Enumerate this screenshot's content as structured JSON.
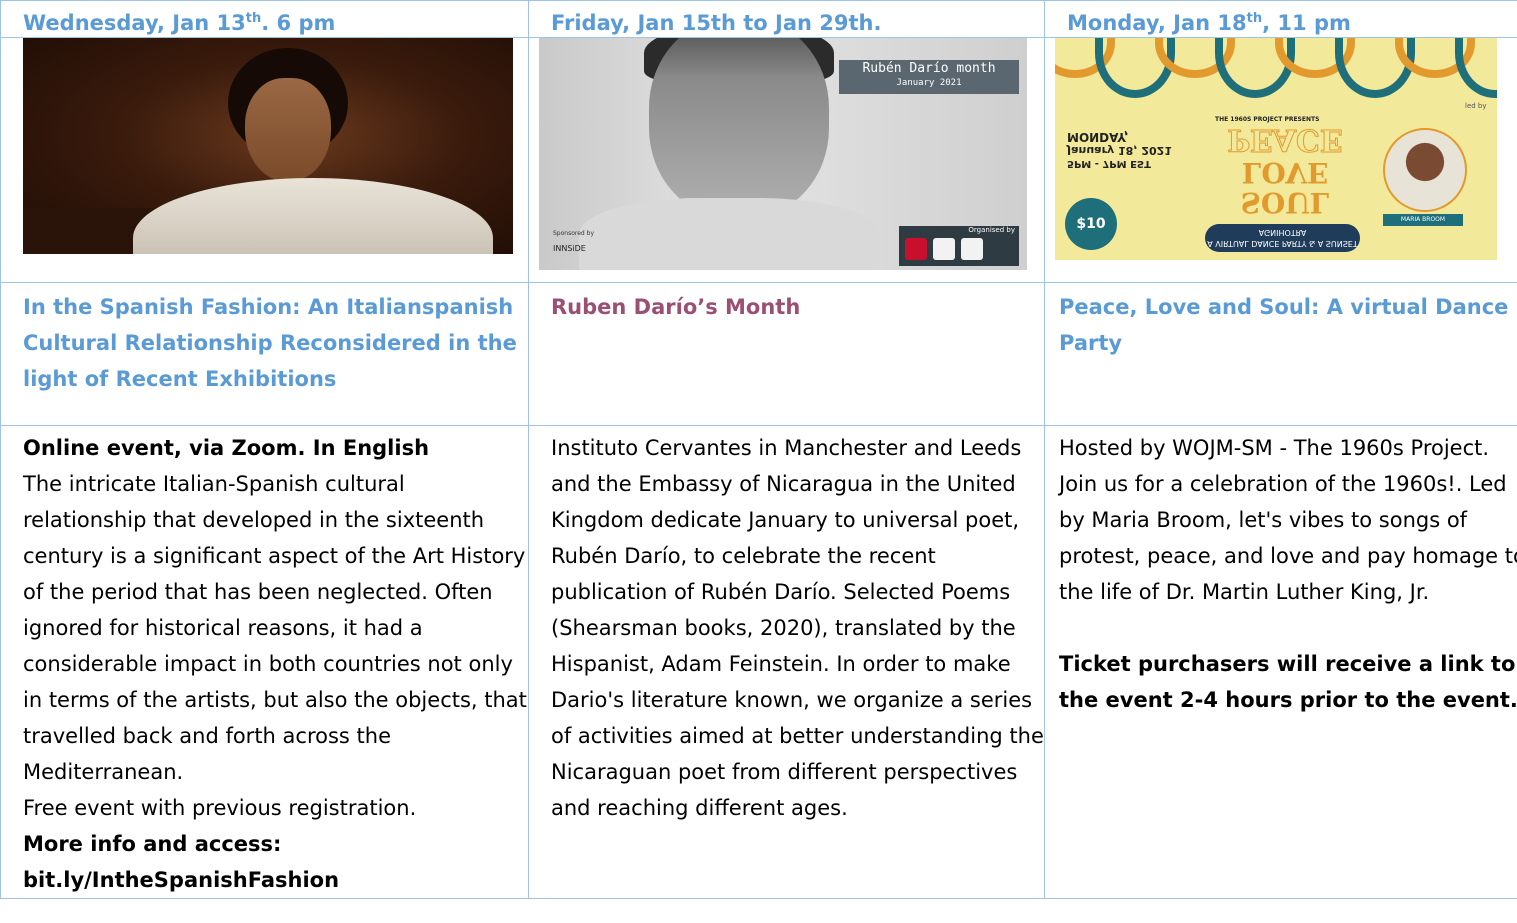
{
  "events": [
    {
      "date_prefix": "Wednesday, Jan 13",
      "date_sup": "th",
      "date_suffix": ". 6 pm",
      "title": "In the Spanish Fashion: An Italianspanish Cultural Relationship Reconsidered in the light of Recent Exhibitions",
      "title_color": "#5b9bd5",
      "image": "portrait-painting",
      "desc_lead": "Online event, via Zoom. In English",
      "desc_body": "The intricate Italian-Spanish cultural relationship that developed in the sixteenth century is a significant aspect of the Art History of the period that has been neglected. Often ignored for historical reasons, it had a considerable impact in both countries not only in terms of the artists, but also the objects, that travelled back and forth across the Mediterranean.",
      "desc_free": "Free event with previous registration.",
      "desc_more": "More info and access:",
      "desc_link": "bit.ly/IntheSpanishFashion"
    },
    {
      "date_full": "Friday, Jan 15th  to Jan 29th.",
      "title": "Ruben Darío’s Month",
      "title_color": "#9b4f72",
      "image": "ruben-dario-photo",
      "image_banner": "Rubén Darío month",
      "image_banner_sub": "January 2021",
      "image_sponsored": "Sponsored by",
      "image_innside": "INNSiDE",
      "image_organised": "Organised by",
      "desc_body": "Instituto Cervantes in Manchester and Leeds and the Embassy of Nicaragua in the United Kingdom dedicate January to universal poet, Rubén Darío, to celebrate the recent publication of Rubén Darío. Selected Poems (Shearsman books, 2020), translated by the Hispanist, Adam Feinstein. In order to make Dario's literature known, we organize a series of activities aimed at better understanding the Nicaraguan poet from different perspectives and reaching different ages."
    },
    {
      "date_prefix": "Monday, Jan 18",
      "date_sup": "th",
      "date_suffix": ", 11 pm",
      "title": "Peace, Love and Soul: A virtual Dance Party",
      "title_color": "#5b9bd5",
      "image": "peace-love-soul-flyer",
      "flyer_presents": "THE 1960S PROJECT PRESENTS",
      "flyer_day": "MONDAY,",
      "flyer_date": "January 18, 2021",
      "flyer_time": "5PM - 7PM EST",
      "flyer_peace": "PEACE",
      "flyer_love": "LOVE",
      "flyer_soul": "SOUL",
      "flyer_donation": "$10",
      "flyer_pill": "A VIRTUAL DANCE PARTY & A SUNSET AGNIHOTRA",
      "flyer_ledby": "led by",
      "flyer_name": "MARIA BROOM",
      "desc_body": "Hosted by WOJM-SM - The 1960s Project. Join us for a celebration of the 1960s!. Led by Maria Broom, let's vibes to songs of protest, peace, and love and pay homage to the life of Dr. Martin Luther King, Jr.",
      "desc_bold": "Ticket purchasers will receive a link to the event 2-4 hours prior to the event."
    }
  ]
}
